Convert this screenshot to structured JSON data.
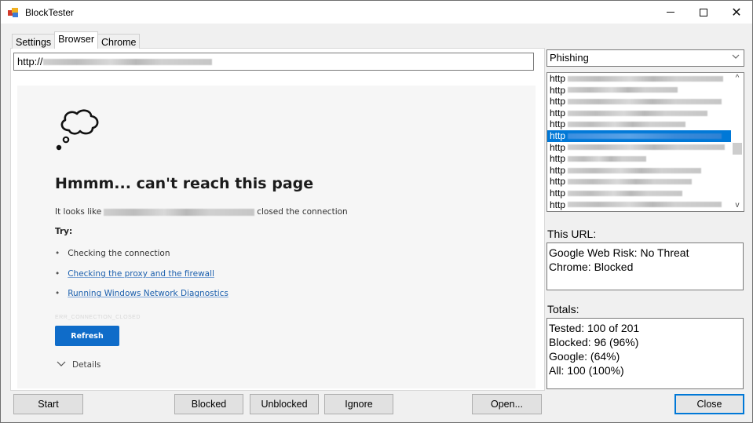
{
  "window": {
    "title": "BlockTester",
    "icon": "app-icon",
    "controls": {
      "minimize": "minimize-icon",
      "maximize": "maximize-icon",
      "close": "close-icon"
    }
  },
  "tabs": [
    {
      "label": "Settings",
      "active": false
    },
    {
      "label": "Browser",
      "active": true
    },
    {
      "label": "Chrome",
      "active": false
    }
  ],
  "url_bar": {
    "value_prefix": "http://",
    "value_obscured": true
  },
  "browser_page": {
    "icon": "thought-cloud-icon",
    "title": "Hmmm... can't reach this page",
    "description_prefix": "It looks like",
    "description_suffix": "closed the connection",
    "try_label": "Try:",
    "suggestions": [
      {
        "text": "Checking the connection",
        "link": false
      },
      {
        "text": "Checking the proxy and the firewall",
        "link": true
      },
      {
        "text": "Running Windows Network Diagnostics",
        "link": true
      }
    ],
    "error_code": "ERR_CONNECTION_CLOSED",
    "refresh_label": "Refresh",
    "details_label": "Details"
  },
  "category_select": {
    "value": "Phishing"
  },
  "url_list": {
    "items": [
      {
        "prefix": "http",
        "selected": false
      },
      {
        "prefix": "http",
        "selected": false
      },
      {
        "prefix": "http",
        "selected": false
      },
      {
        "prefix": "http",
        "selected": false
      },
      {
        "prefix": "http",
        "selected": false
      },
      {
        "prefix": "http",
        "selected": true
      },
      {
        "prefix": "http",
        "selected": false
      },
      {
        "prefix": "http",
        "selected": false
      },
      {
        "prefix": "http",
        "selected": false
      },
      {
        "prefix": "http",
        "selected": false
      },
      {
        "prefix": "http",
        "selected": false
      },
      {
        "prefix": "http",
        "selected": false
      }
    ]
  },
  "this_url": {
    "label": "This URL:",
    "lines": [
      "Google Web Risk: No Threat",
      "Chrome: Blocked"
    ]
  },
  "totals": {
    "label": "Totals:",
    "lines": [
      "Tested: 100 of 201",
      "Blocked: 96 (96%)",
      "Google: (64%)",
      "All: 100 (100%)"
    ]
  },
  "buttons": {
    "start": "Start",
    "blocked": "Blocked",
    "unblocked": "Unblocked",
    "ignore": "Ignore",
    "open": "Open...",
    "close": "Close"
  },
  "colors": {
    "accent": "#0078d7",
    "refresh_button": "#0f6cc9",
    "link": "#1b5fad"
  }
}
